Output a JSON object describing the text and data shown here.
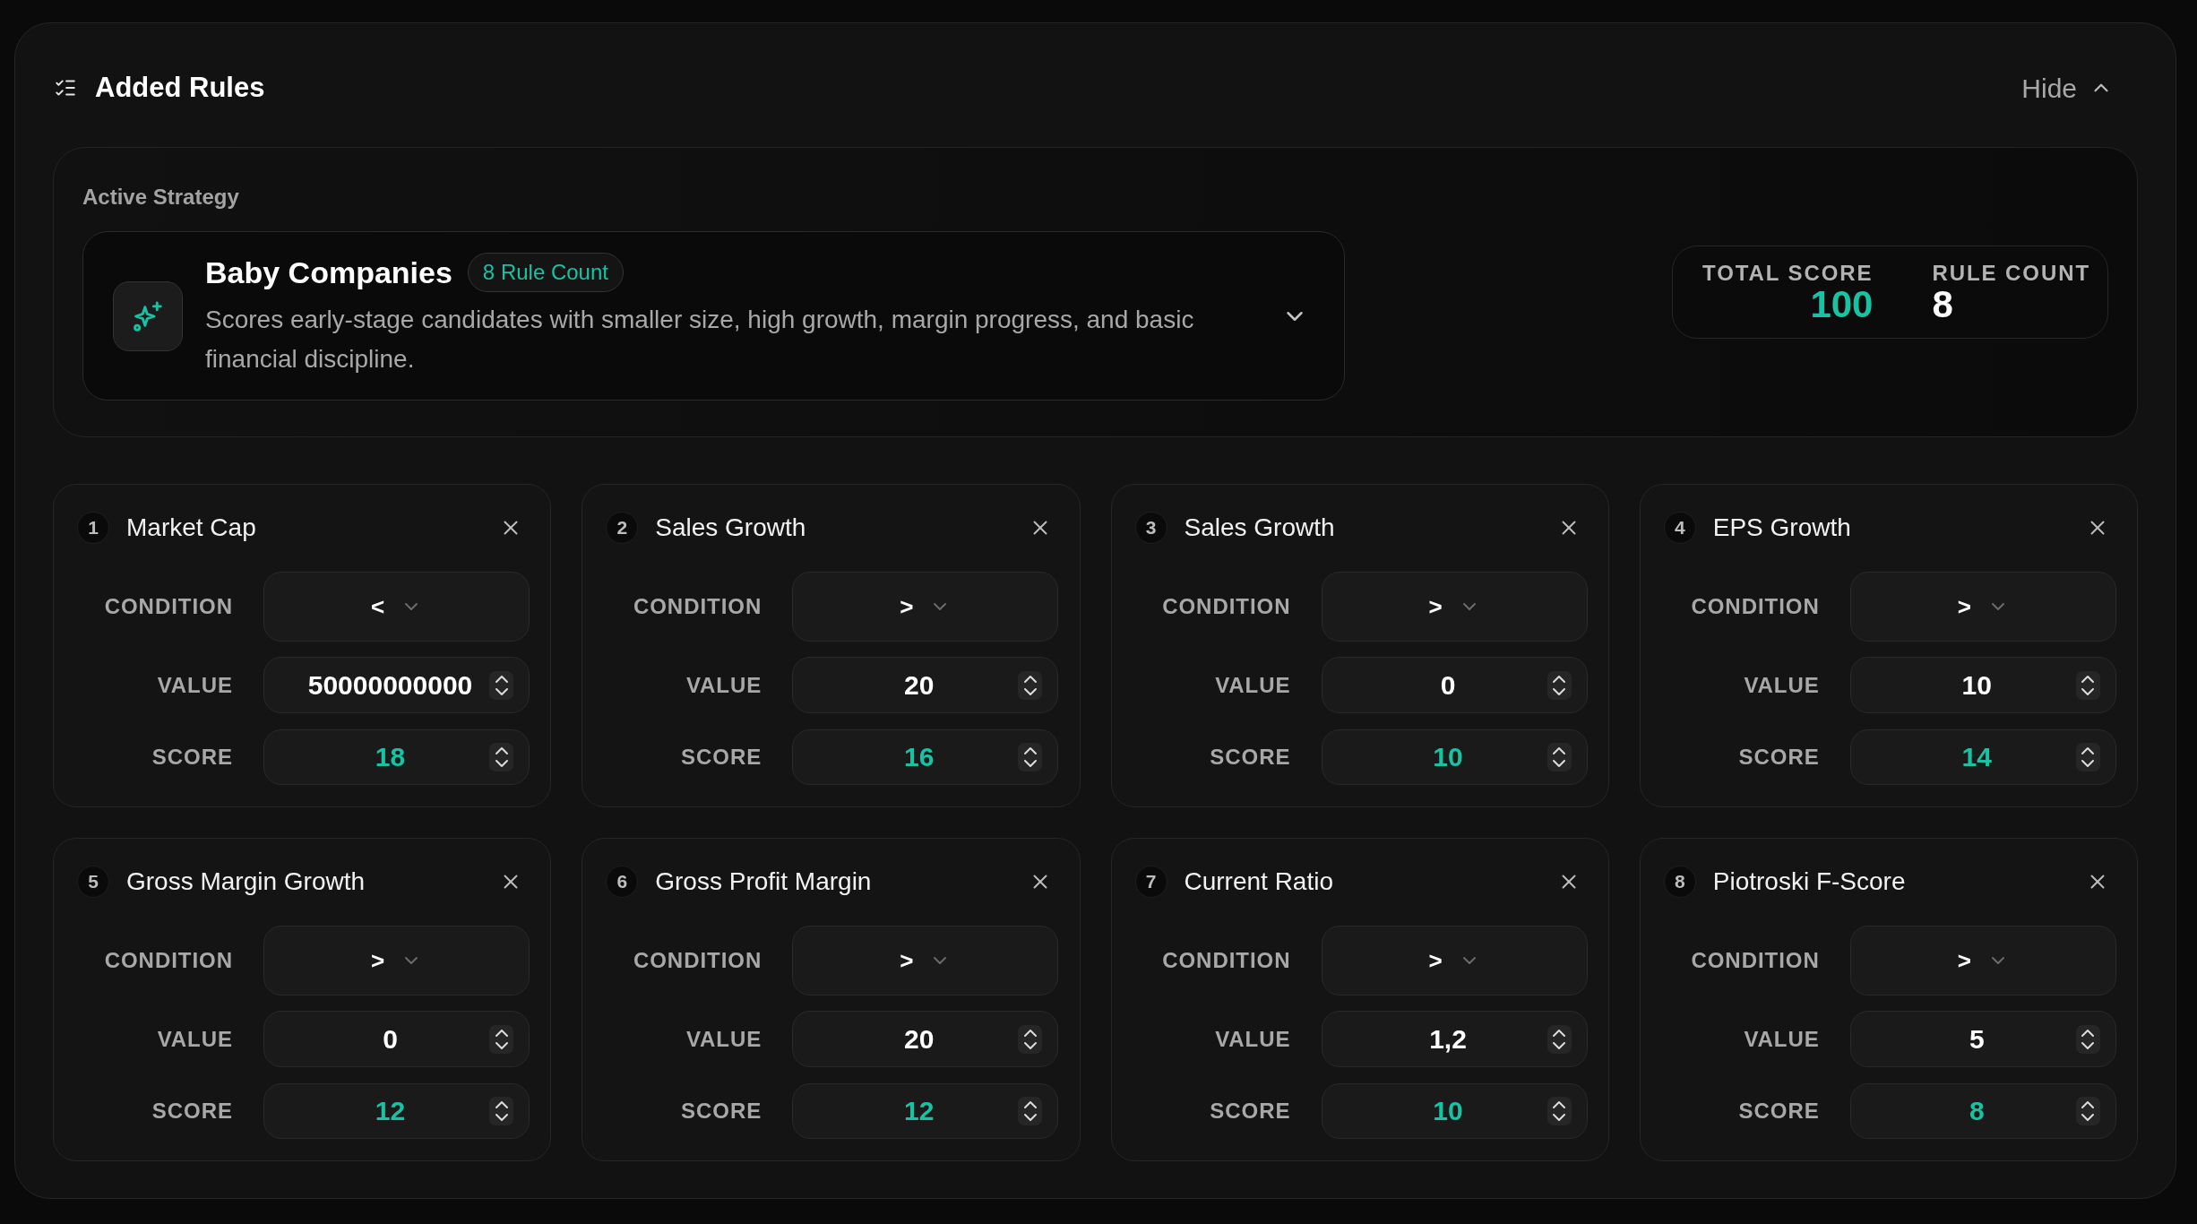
{
  "header": {
    "title": "Added Rules",
    "toggle_label": "Hide"
  },
  "active_strategy": {
    "label": "Active Strategy",
    "name": "Baby Companies",
    "badge": "8 Rule Count",
    "description": "Scores early-stage candidates with smaller size, high growth, margin progress, and basic financial discipline."
  },
  "summary": [
    {
      "kind": "score",
      "label": "TOTAL SCORE",
      "value": "100"
    },
    {
      "kind": "count",
      "label": "RULE COUNT",
      "value": "8"
    }
  ],
  "rules": [
    {
      "number": "1",
      "name": "Market Cap",
      "fields": [
        {
          "kind": "select",
          "label": "CONDITION",
          "value": "<"
        },
        {
          "kind": "number",
          "label": "VALUE",
          "value": "50000000000"
        },
        {
          "kind": "score",
          "label": "SCORE",
          "value": "18"
        }
      ]
    },
    {
      "number": "2",
      "name": "Sales Growth",
      "fields": [
        {
          "kind": "select",
          "label": "CONDITION",
          "value": ">"
        },
        {
          "kind": "number",
          "label": "VALUE",
          "value": "20"
        },
        {
          "kind": "score",
          "label": "SCORE",
          "value": "16"
        }
      ]
    },
    {
      "number": "3",
      "name": "Sales Growth",
      "fields": [
        {
          "kind": "select",
          "label": "CONDITION",
          "value": ">"
        },
        {
          "kind": "number",
          "label": "VALUE",
          "value": "0"
        },
        {
          "kind": "score",
          "label": "SCORE",
          "value": "10"
        }
      ]
    },
    {
      "number": "4",
      "name": "EPS Growth",
      "fields": [
        {
          "kind": "select",
          "label": "CONDITION",
          "value": ">"
        },
        {
          "kind": "number",
          "label": "VALUE",
          "value": "10"
        },
        {
          "kind": "score",
          "label": "SCORE",
          "value": "14"
        }
      ]
    },
    {
      "number": "5",
      "name": "Gross Margin Growth",
      "fields": [
        {
          "kind": "select",
          "label": "CONDITION",
          "value": ">"
        },
        {
          "kind": "number",
          "label": "VALUE",
          "value": "0"
        },
        {
          "kind": "score",
          "label": "SCORE",
          "value": "12"
        }
      ]
    },
    {
      "number": "6",
      "name": "Gross Profit Margin",
      "fields": [
        {
          "kind": "select",
          "label": "CONDITION",
          "value": ">"
        },
        {
          "kind": "number",
          "label": "VALUE",
          "value": "20"
        },
        {
          "kind": "score",
          "label": "SCORE",
          "value": "12"
        }
      ]
    },
    {
      "number": "7",
      "name": "Current Ratio",
      "fields": [
        {
          "kind": "select",
          "label": "CONDITION",
          "value": ">"
        },
        {
          "kind": "number",
          "label": "VALUE",
          "value": "1,2"
        },
        {
          "kind": "score",
          "label": "SCORE",
          "value": "10"
        }
      ]
    },
    {
      "number": "8",
      "name": "Piotroski F-Score",
      "fields": [
        {
          "kind": "select",
          "label": "CONDITION",
          "value": ">"
        },
        {
          "kind": "number",
          "label": "VALUE",
          "value": "5"
        },
        {
          "kind": "score",
          "label": "SCORE",
          "value": "8"
        }
      ]
    }
  ]
}
